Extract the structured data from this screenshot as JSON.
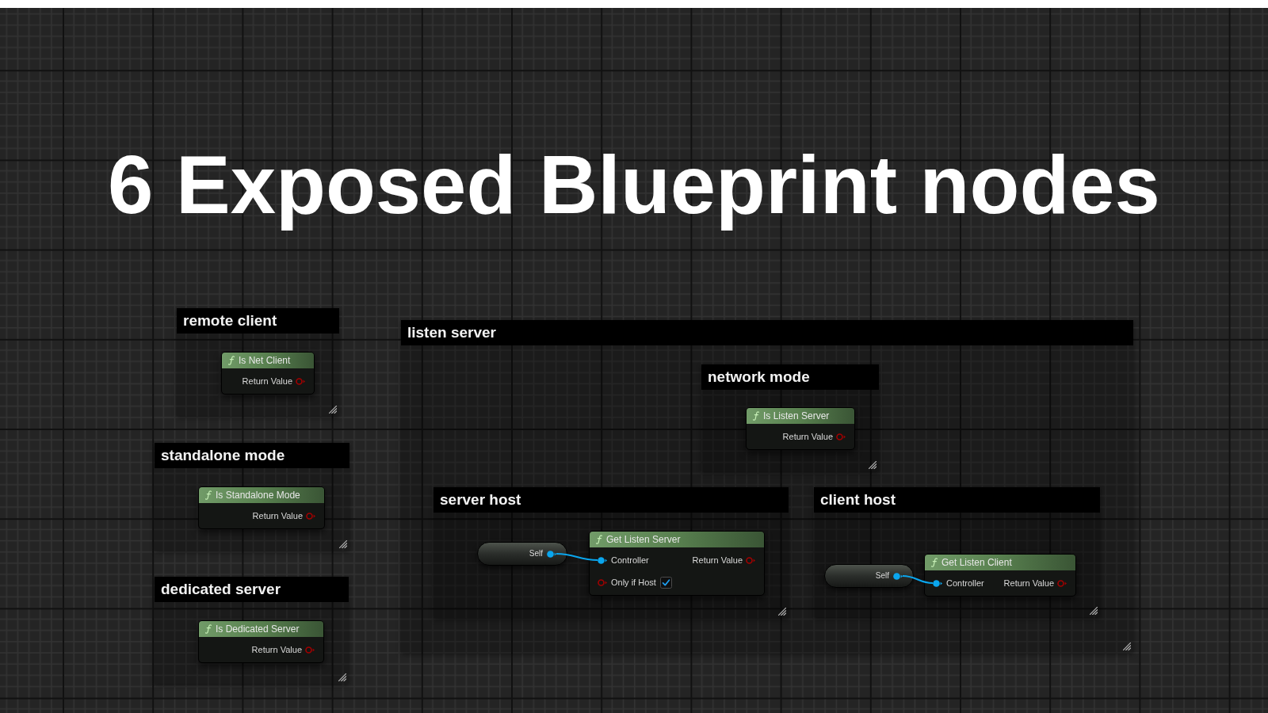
{
  "title": "6 Exposed Blueprint nodes",
  "comments": [
    {
      "title": "remote client",
      "nodes": [
        {
          "kind": "function",
          "title": "Is Net Client",
          "outputs": [
            {
              "kind": "bool",
              "label": "Return Value"
            }
          ]
        }
      ]
    },
    {
      "title": "standalone mode",
      "nodes": [
        {
          "kind": "function",
          "title": "Is Standalone Mode",
          "outputs": [
            {
              "kind": "bool",
              "label": "Return Value"
            }
          ]
        }
      ]
    },
    {
      "title": "dedicated server",
      "nodes": [
        {
          "kind": "function",
          "title": "Is Dedicated Server",
          "outputs": [
            {
              "kind": "bool",
              "label": "Return Value"
            }
          ]
        }
      ]
    },
    {
      "title": "listen server",
      "comments": [
        {
          "title": "network mode",
          "nodes": [
            {
              "kind": "function",
              "title": "Is Listen Server",
              "outputs": [
                {
                  "kind": "bool",
                  "label": "Return Value"
                }
              ]
            }
          ]
        },
        {
          "title": "server host",
          "nodes": [
            {
              "kind": "self",
              "label": "Self"
            },
            {
              "kind": "function",
              "title": "Get Listen Server",
              "inputs": [
                {
                  "kind": "object",
                  "label": "Controller",
                  "connected": true
                },
                {
                  "kind": "bool",
                  "label": "Only if Host",
                  "checked": true
                }
              ],
              "outputs": [
                {
                  "kind": "bool",
                  "label": "Return Value"
                }
              ]
            }
          ]
        },
        {
          "title": "client host",
          "nodes": [
            {
              "kind": "self",
              "label": "Self"
            },
            {
              "kind": "function",
              "title": "Get Listen Client",
              "inputs": [
                {
                  "kind": "object",
                  "label": "Controller",
                  "connected": true
                }
              ],
              "outputs": [
                {
                  "kind": "bool",
                  "label": "Return Value"
                }
              ]
            }
          ]
        }
      ]
    }
  ]
}
